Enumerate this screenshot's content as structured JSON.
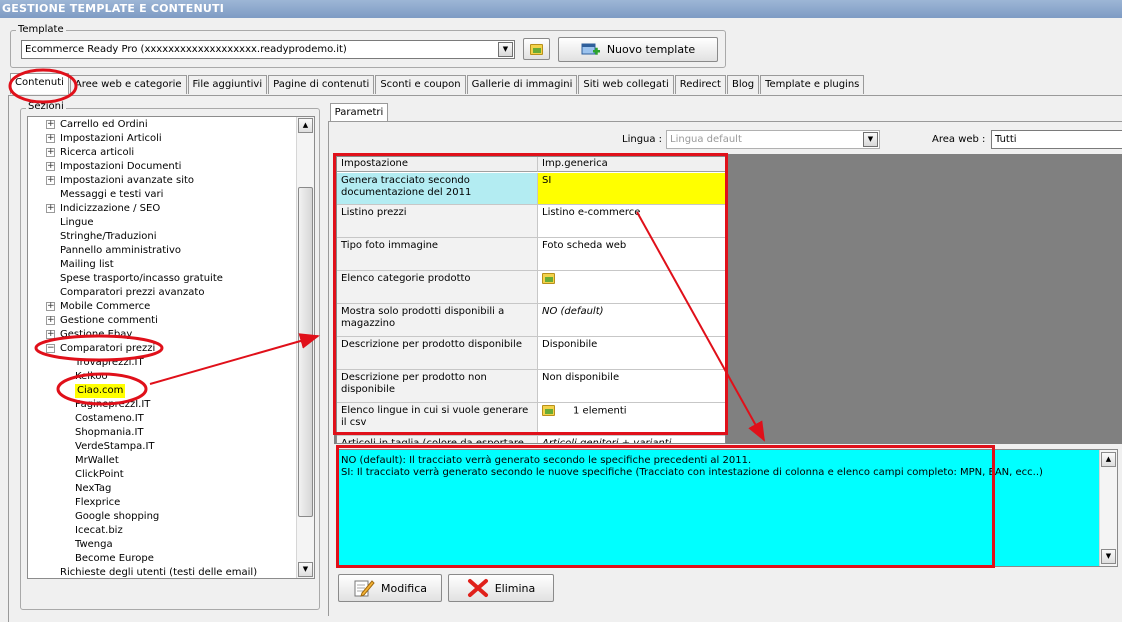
{
  "window": {
    "title": "GESTIONE TEMPLATE E CONTENUTI"
  },
  "template_section": {
    "legend": "Template",
    "selected_template": "Ecommerce Ready Pro (xxxxxxxxxxxxxxxxxxx.readyprodemo.it)",
    "new_template_label": "Nuovo template"
  },
  "tabs": [
    "Contenuti",
    "Aree web e categorie",
    "File aggiuntivi",
    "Pagine di contenuti",
    "Sconti e coupon",
    "Gallerie di immagini",
    "Siti web collegati",
    "Redirect",
    "Blog",
    "Template e plugins"
  ],
  "sections_legend": "Sezioni",
  "tree": [
    {
      "label": "Carrello ed Ordini",
      "level": 0,
      "expander": "+"
    },
    {
      "label": "Impostazioni Articoli",
      "level": 0,
      "expander": "+"
    },
    {
      "label": "Ricerca articoli",
      "level": 0,
      "expander": "+"
    },
    {
      "label": "Impostazioni Documenti",
      "level": 0,
      "expander": "+"
    },
    {
      "label": "Impostazioni avanzate sito",
      "level": 0,
      "expander": "+"
    },
    {
      "label": "Messaggi e testi vari",
      "level": 0,
      "expander": ""
    },
    {
      "label": "Indicizzazione / SEO",
      "level": 0,
      "expander": "+"
    },
    {
      "label": "Lingue",
      "level": 0,
      "expander": ""
    },
    {
      "label": "Stringhe/Traduzioni",
      "level": 0,
      "expander": ""
    },
    {
      "label": "Pannello amministrativo",
      "level": 0,
      "expander": ""
    },
    {
      "label": "Mailing list",
      "level": 0,
      "expander": ""
    },
    {
      "label": "Spese trasporto/incasso gratuite",
      "level": 0,
      "expander": ""
    },
    {
      "label": "Comparatori prezzi avanzato",
      "level": 0,
      "expander": ""
    },
    {
      "label": "Mobile Commerce",
      "level": 0,
      "expander": "+"
    },
    {
      "label": "Gestione commenti",
      "level": 0,
      "expander": "+"
    },
    {
      "label": "Gestione Ebay",
      "level": 0,
      "expander": "+"
    },
    {
      "label": "Comparatori prezzi",
      "level": 0,
      "expander": "−"
    },
    {
      "label": "Trovaprezzi.IT",
      "level": 1,
      "expander": ""
    },
    {
      "label": "Kelkoo",
      "level": 1,
      "expander": ""
    },
    {
      "label": "Ciao.com",
      "level": 1,
      "expander": "",
      "selected": true
    },
    {
      "label": "PagineprezzI.IT",
      "level": 1,
      "expander": ""
    },
    {
      "label": "Costameno.IT",
      "level": 1,
      "expander": ""
    },
    {
      "label": "Shopmania.IT",
      "level": 1,
      "expander": ""
    },
    {
      "label": "VerdeStampa.IT",
      "level": 1,
      "expander": ""
    },
    {
      "label": "MrWallet",
      "level": 1,
      "expander": ""
    },
    {
      "label": "ClickPoint",
      "level": 1,
      "expander": ""
    },
    {
      "label": "NexTag",
      "level": 1,
      "expander": ""
    },
    {
      "label": "Flexprice",
      "level": 1,
      "expander": ""
    },
    {
      "label": "Google shopping",
      "level": 1,
      "expander": ""
    },
    {
      "label": "Icecat.biz",
      "level": 1,
      "expander": ""
    },
    {
      "label": "Twenga",
      "level": 1,
      "expander": ""
    },
    {
      "label": "Become Europe",
      "level": 1,
      "expander": ""
    },
    {
      "label": "Richieste degli utenti (testi delle email)",
      "level": 0,
      "expander": ""
    }
  ],
  "params": {
    "tab_label": "Parametri",
    "lingua_label": "Lingua :",
    "lingua_value": "Lingua default",
    "area_web_label": "Area web :",
    "area_web_value": "Tutti"
  },
  "grid": {
    "headers": [
      "Impostazione",
      "Imp.generica"
    ],
    "rows": [
      {
        "name": "Genera tracciato secondo documentazione del 2011",
        "value": "SI",
        "icon": "",
        "highlighted": true
      },
      {
        "name": "Listino prezzi",
        "value": "Listino e-commerce",
        "icon": ""
      },
      {
        "name": "Tipo foto immagine",
        "value": "Foto scheda web",
        "icon": ""
      },
      {
        "name": "Elenco categorie prodotto",
        "value": "",
        "icon": "folder-icon"
      },
      {
        "name": "Mostra solo prodotti disponibili a magazzino",
        "value": "NO (default)",
        "icon": "",
        "italic": true
      },
      {
        "name": "Descrizione per prodotto disponibile",
        "value": "Disponibile",
        "icon": ""
      },
      {
        "name": "Descrizione per prodotto non disponibile",
        "value": "Non disponibile",
        "icon": ""
      },
      {
        "name": "Elenco lingue in cui si vuole generare il csv",
        "value": "1 elementi",
        "icon": "folder-icon"
      },
      {
        "name": "Articoli in taglia (colore da esportare",
        "value": "Articoli genitori + varianti",
        "icon": "",
        "italic": true
      }
    ]
  },
  "description": {
    "line1": "NO (default): Il tracciato verrà generato secondo le specifiche precedenti al 2011.",
    "line2": "SI: Il tracciato verrà generato secondo le nuove specifiche (Tracciato con intestazione di colonna e elenco campi completo: MPN, EAN, ecc..)"
  },
  "buttons": {
    "modifica": "Modifica",
    "elimina": "Elimina"
  },
  "colors": {
    "title_bar": "#8aa6cc",
    "highlight_row_name": "#b3ecf2",
    "highlight_row_value": "#ffff00",
    "description_bg": "#00ffff",
    "annotation_red": "#e0101a",
    "grey_area": "#808080"
  }
}
